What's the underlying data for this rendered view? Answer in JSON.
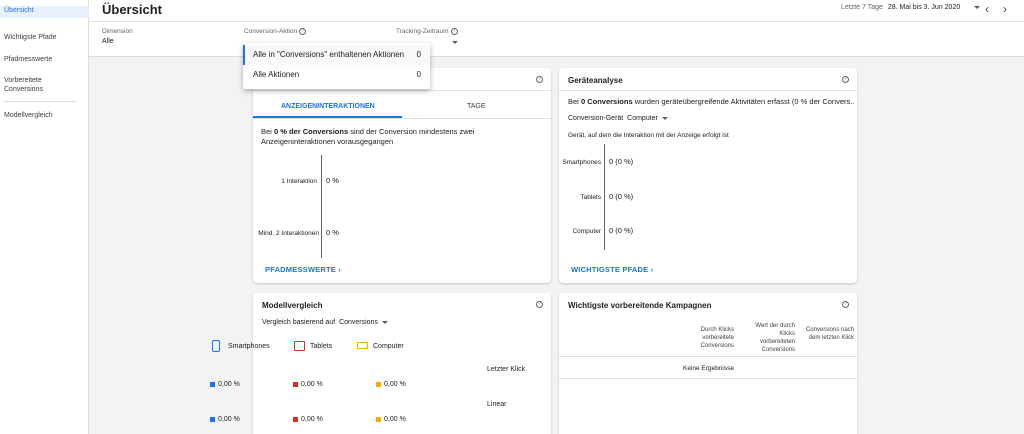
{
  "sidebar": {
    "items": [
      {
        "label": "Übersicht",
        "active": true
      },
      {
        "label": "Wichtigste Pfade"
      },
      {
        "label": "Pfadmesswerte"
      },
      {
        "label": "Vorbereitete Conversions"
      },
      {
        "label": "Modellvergleich"
      }
    ]
  },
  "header": {
    "title": "Übersicht",
    "date_range_label": "Letzte 7 Tage",
    "date_range_value": "28. Mai bis 3. Jun 2020",
    "filters": {
      "dimension": {
        "label": "Dimension",
        "value": "Alle"
      },
      "conversion_action": {
        "label": "Conversion-Aktion"
      },
      "tracking_period": {
        "label": "Tracking-Zeitraum"
      }
    }
  },
  "dropdown": {
    "options": [
      {
        "label": "Alle in \"Conversions\" enthaltenen Aktionen",
        "count": "0",
        "selected": true
      },
      {
        "label": "Alle Aktionen",
        "count": "0"
      }
    ]
  },
  "interactions_card": {
    "tabs": [
      "ANZEIGENINTERAKTIONEN",
      "TAGE"
    ],
    "summary_prefix": "Bei ",
    "summary_bold": "0 % der Conversions",
    "summary_suffix": " sind der Conversion mindestens zwei Anzeigeninteraktionen vorausgegangen",
    "rows": [
      {
        "label": "1 Interaktion",
        "value": "0 %"
      },
      {
        "label": "Mind. 2 Interaktionen",
        "value": "0 %"
      }
    ],
    "link": "PFADMESSWERTE"
  },
  "devices_card": {
    "title": "Geräteanalyse",
    "summary_prefix": "Bei ",
    "summary_bold": "0 Conversions",
    "summary_suffix": " wurden geräteübergreifende Aktivitäten erfasst (0 % der Convers...",
    "selector_label": "Conversion-Gerät",
    "selector_value": "Computer",
    "subtitle": "Gerät, auf dem die Interaktion mit der Anzeige erfolgt ist",
    "rows": [
      {
        "label": "Smartphones",
        "value": "0 (0 %)"
      },
      {
        "label": "Tablets",
        "value": "0 (0 %)"
      },
      {
        "label": "Computer",
        "value": "0 (0 %)"
      }
    ],
    "link": "WICHTIGSTE PFADE"
  },
  "model_card": {
    "title": "Modellvergleich",
    "compare_label": "Vergleich basierend auf",
    "compare_value": "Conversions",
    "legend": [
      {
        "label": "Smartphones",
        "color": "#1a73e8"
      },
      {
        "label": "Tablets",
        "color": "#d93025"
      },
      {
        "label": "Computer",
        "color": "#f9ab00"
      }
    ],
    "models": [
      {
        "label": "Letzter Klick",
        "values": [
          "0,00 %",
          "0,00 %",
          "0,00 %"
        ]
      },
      {
        "label": "Linear",
        "values": [
          "0,00 %",
          "0,00 %",
          "0,00 %"
        ]
      }
    ]
  },
  "campaigns_card": {
    "title": "Wichtigste vorbereitende Kampagnen",
    "columns": [
      "Durch Klicks vorbereitete Conversions",
      "Wert der durch Klicks vorbereiteten Conversions",
      "Conversions nach dem letzten Klick"
    ],
    "empty": "Keine Ergebnisse"
  },
  "colors": {
    "accent": "#1a73e8",
    "smartphones": "#1a73e8",
    "tablets": "#d93025",
    "computer": "#f9ab00"
  }
}
